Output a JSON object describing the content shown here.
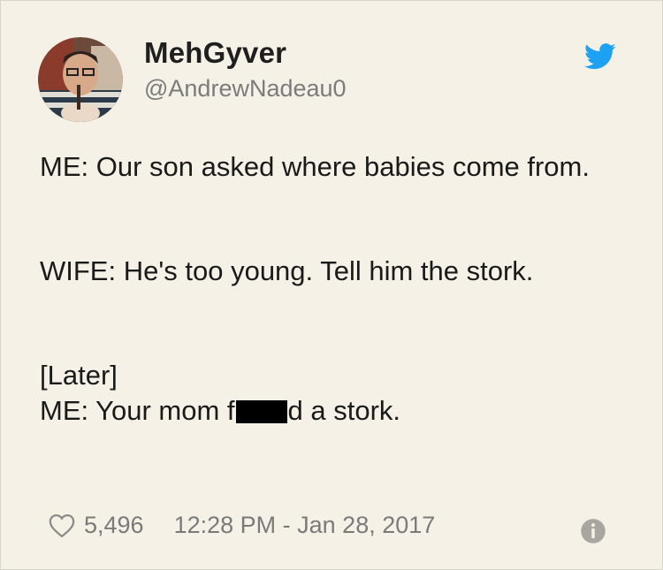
{
  "tweet": {
    "display_name": "MehGyver",
    "handle": "@AndrewNadeau0",
    "lines": {
      "p1": "ME: Our son asked where babies come from.",
      "p2": "WIFE: He's too young. Tell him the stork.",
      "p3_line1": "[Later]",
      "p3_line2_start": "ME: Your mom f",
      "p3_line2_end": "d a stork."
    },
    "likes": "5,496",
    "timestamp": "12:28 PM - Jan 28, 2017"
  },
  "icons": {
    "brand": "twitter-bird-icon",
    "like": "heart-icon",
    "info": "info-icon"
  },
  "colors": {
    "background": "#f5f1e6",
    "twitter_blue": "#1da1f2",
    "muted_text": "#7a7a7a"
  }
}
